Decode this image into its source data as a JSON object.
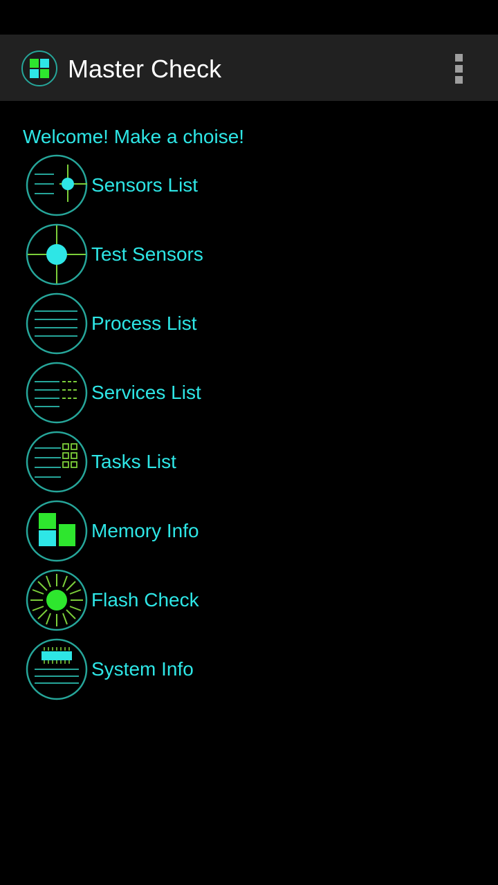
{
  "app_bar": {
    "title": "Master Check",
    "app_icon": "grid-app-icon",
    "overflow_icon": "overflow-menu-icon"
  },
  "welcome_text": "Welcome! Make a choise!",
  "menu": {
    "items": [
      {
        "label": "Sensors List",
        "icon": "sensors-list-icon"
      },
      {
        "label": "Test Sensors",
        "icon": "test-sensors-icon"
      },
      {
        "label": "Process List",
        "icon": "process-list-icon"
      },
      {
        "label": "Services List",
        "icon": "services-list-icon"
      },
      {
        "label": "Tasks List",
        "icon": "tasks-list-icon"
      },
      {
        "label": "Memory Info",
        "icon": "memory-info-icon"
      },
      {
        "label": "Flash Check",
        "icon": "flash-check-icon"
      },
      {
        "label": "System Info",
        "icon": "system-info-icon"
      }
    ]
  },
  "colors": {
    "accent_cyan": "#2ee6e6",
    "accent_green": "#2ee62e",
    "app_bar_bg": "#212121",
    "background": "#000000",
    "circle_stroke": "#26a69a"
  }
}
